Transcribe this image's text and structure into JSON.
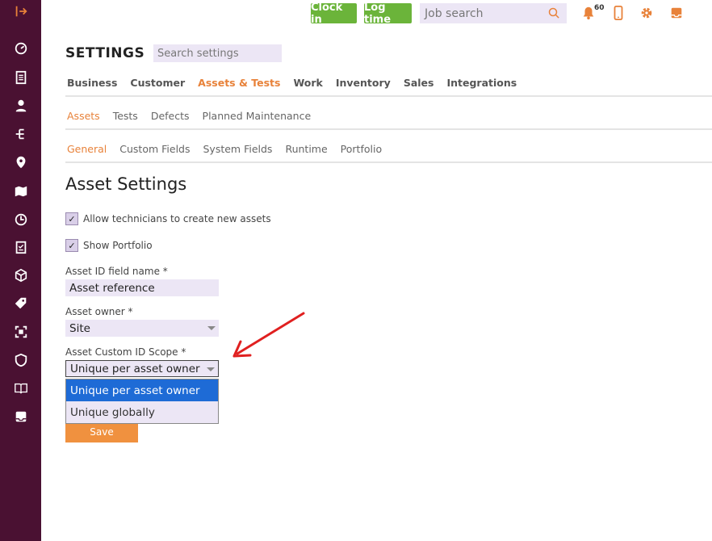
{
  "topbar": {
    "clock_in": "Clock in",
    "log_time": "Log time",
    "job_search_placeholder": "Job search",
    "notification_count": "60",
    "accent_color": "#6bb43a",
    "icon_color": "#e8823a"
  },
  "sidebar": {
    "background": "#4a1132",
    "icons": [
      "collapse-icon",
      "dashboard-icon",
      "document-list-icon",
      "user-icon",
      "hierarchy-icon",
      "location-pin-icon",
      "map-icon",
      "clock-icon",
      "checklist-icon",
      "box-icon",
      "tag-icon",
      "scan-icon",
      "shield-icon",
      "book-icon",
      "inbox-icon"
    ]
  },
  "settings": {
    "title": "SETTINGS",
    "search_placeholder": "Search settings"
  },
  "main_tabs": [
    {
      "label": "Business",
      "active": false
    },
    {
      "label": "Customer",
      "active": false
    },
    {
      "label": "Assets & Tests",
      "active": true
    },
    {
      "label": "Work",
      "active": false
    },
    {
      "label": "Inventory",
      "active": false
    },
    {
      "label": "Sales",
      "active": false
    },
    {
      "label": "Integrations",
      "active": false
    }
  ],
  "sub_tabs": [
    {
      "label": "Assets",
      "active": true
    },
    {
      "label": "Tests",
      "active": false
    },
    {
      "label": "Defects",
      "active": false
    },
    {
      "label": "Planned Maintenance",
      "active": false
    }
  ],
  "section_tabs": [
    {
      "label": "General",
      "active": true
    },
    {
      "label": "Custom Fields",
      "active": false
    },
    {
      "label": "System Fields",
      "active": false
    },
    {
      "label": "Runtime",
      "active": false
    },
    {
      "label": "Portfolio",
      "active": false
    }
  ],
  "asset_settings": {
    "heading": "Asset Settings",
    "allow_technicians_label": "Allow technicians to create new assets",
    "allow_technicians_checked": true,
    "show_portfolio_label": "Show Portfolio",
    "show_portfolio_checked": true,
    "asset_id_label": "Asset ID field name *",
    "asset_id_value": "Asset reference",
    "asset_owner_label": "Asset owner *",
    "asset_owner_value": "Site",
    "custom_id_scope_label": "Asset Custom ID Scope *",
    "custom_id_scope_value": "Unique per asset owner",
    "custom_id_scope_options": [
      "Unique per asset owner",
      "Unique globally"
    ],
    "save_label": "Save"
  },
  "annotation": {
    "arrow_color": "#e02020"
  }
}
